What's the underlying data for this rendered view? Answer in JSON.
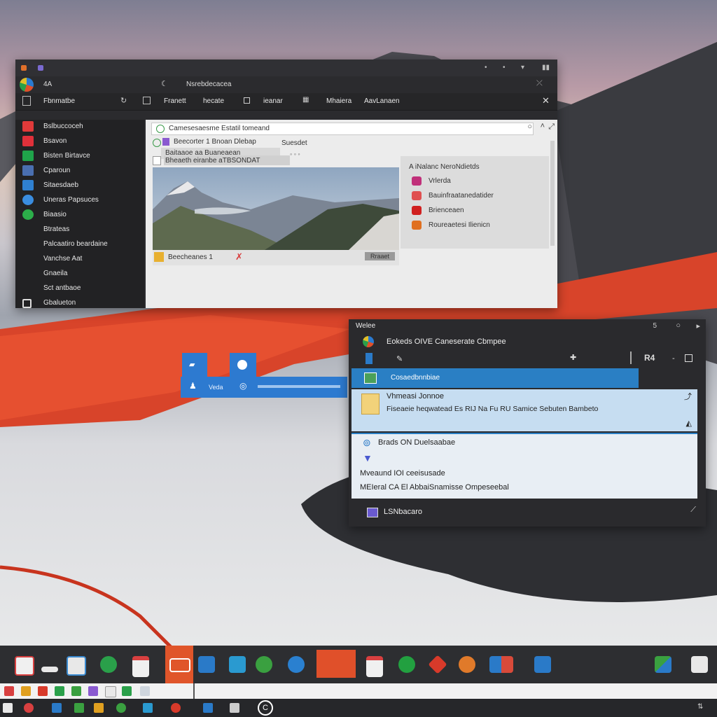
{
  "window_main": {
    "title_text": "Nsrebdecacea",
    "tab_label": "4A",
    "menu": [
      "Fbnmatbe",
      "Franett",
      "hecate",
      "ieanar",
      "Mhaiera",
      "AavLanaen"
    ],
    "sidebar": [
      {
        "label": "Bslbuccoceh",
        "color": "#e03a3a"
      },
      {
        "label": "Bsavon",
        "color": "#e0303a"
      },
      {
        "label": "Bisten Birtavce",
        "color": "#1fa34a"
      },
      {
        "label": "Cparoun",
        "color": "#4a6fb0"
      },
      {
        "label": "Sitaesdaeb",
        "color": "#2f80d0"
      },
      {
        "label": "Uneras Papsuces",
        "color": "#3a8de0"
      },
      {
        "label": "Biaasio",
        "color": "#2cae4a"
      },
      {
        "label": "Btrateas",
        "color": ""
      },
      {
        "label": "Palcaatiro beardaine",
        "color": ""
      },
      {
        "label": "Vanchse Aat",
        "color": ""
      },
      {
        "label": "Gnaeila",
        "color": ""
      },
      {
        "label": "Sct antbaoe",
        "color": ""
      },
      {
        "label": "Gbalueton",
        "color": "#dddddd"
      }
    ],
    "address": "Camesesaesme Estatil tomeand",
    "line1": "Beecorter 1 Bnoan Dlebap",
    "line1b": "Suesdet",
    "line2": "Baitaaoe aa Buaneaean",
    "line3": "Bheaeth eiranbe aTBSONDAT",
    "caption": "Beecheanes 1",
    "caption_right": "Rraaet",
    "right_panel": {
      "header": "A iNalanc NeroNdietds",
      "items": [
        {
          "label": "Vrlerda",
          "color": "#c0307a"
        },
        {
          "label": "Bauinfraatanedatider",
          "color": "#e05050"
        },
        {
          "label": "Brienceaen",
          "color": "#d02020"
        },
        {
          "label": "Roureaetesi Ilienicn",
          "color": "#e07020"
        }
      ]
    }
  },
  "window_secondary": {
    "title": "Welee",
    "header": "Eokeds OIVE Caneserate Cbmpee",
    "selected_row": "Cosaedbnnbiae",
    "card_title": "Vhmeasi Jonnoe",
    "card_text": "Fiseaeie heqwatead Es RIJ Na Fu RU Samice Sebuten Bambeto",
    "list": [
      "Brads ON Duelsaabae",
      "Mveaund IOI ceeisusade",
      "MEIeral CA El AbbaiSnamisse Ompeseebal"
    ],
    "footer": "LSNbacaro"
  },
  "floating_tiles": {
    "label": "Veda"
  },
  "taskbar_icons": [
    {
      "name": "presentation-icon",
      "color": "#d84040"
    },
    {
      "name": "minimize-icon",
      "color": "#dddddd"
    },
    {
      "name": "photo-viewer-icon",
      "color": "#3a8ad0"
    },
    {
      "name": "recycle-icon",
      "color": "#2aa04a"
    },
    {
      "name": "document-icon",
      "color": "#d84040"
    },
    {
      "name": "tiles-icon",
      "color": "#e0552a"
    },
    {
      "name": "book-icon",
      "color": "#2a7ac8"
    },
    {
      "name": "store-icon",
      "color": "#2a9ad0"
    },
    {
      "name": "chrome-like-icon",
      "color": "#3aa040"
    },
    {
      "name": "edge-like-icon",
      "color": "#2a80d0"
    },
    {
      "name": "active-app-icon",
      "color": "#e0502a"
    },
    {
      "name": "calendar-icon",
      "color": "#d84040"
    },
    {
      "name": "recycle-green-icon",
      "color": "#22a040"
    },
    {
      "name": "gem-icon",
      "color": "#d83a2a"
    },
    {
      "name": "firefox-like-icon",
      "color": "#e07a2a"
    },
    {
      "name": "photos-icon",
      "color": "#d84a3a"
    },
    {
      "name": "mail-icon",
      "color": "#2a7ac8"
    },
    {
      "name": "network-icon",
      "color": "#3aa040"
    },
    {
      "name": "notes-icon",
      "color": "#e8e8e8"
    }
  ],
  "accent": "#2a7fc4"
}
